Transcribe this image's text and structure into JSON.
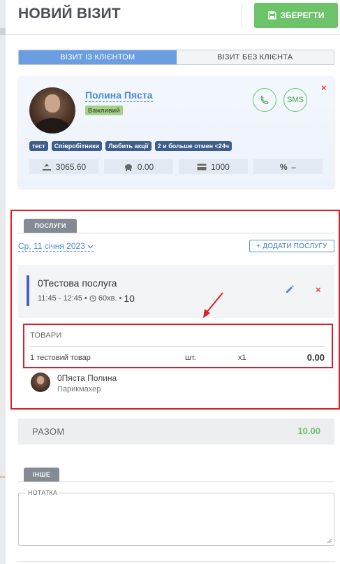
{
  "header": {
    "title": "НОВИЙ ВІЗИТ",
    "save_label": "ЗБЕРЕГТИ"
  },
  "visit_type": {
    "options": [
      "ВІЗИТ ІЗ КЛІЄНТОМ",
      "ВІЗИТ БЕЗ КЛІЄНТА"
    ],
    "selected": "ВІЗИТ ІЗ КЛІЄНТОМ"
  },
  "client": {
    "name": "Полина Пяста",
    "badge": "Важливий",
    "sms_label": "SMS",
    "close_symbol": "×",
    "tags": [
      "тест",
      "Співробітники",
      "Любить акції",
      "2 и больше отмен <24ч"
    ],
    "stats": {
      "spent": "3065.60",
      "balance": "0.00",
      "card": "1000",
      "discount": "–"
    }
  },
  "services_section": {
    "tab_label": "ПОСЛУГИ",
    "date": "Ср, 11 січня 2023",
    "add_label": "+ ДОДАТИ ПОСЛУГУ",
    "service": {
      "name": "0Тестова послуга",
      "time": "11:45 - 12:45",
      "separator": "•",
      "duration": "60хв.",
      "count": "10",
      "delete_symbol": "×"
    },
    "goods": {
      "title": "ТОВАРИ",
      "items": [
        {
          "name": "1 тестовий товар",
          "unit": "шт.",
          "qty": "x1",
          "total": "0.00"
        }
      ]
    },
    "master": {
      "name": "0Пяста Полина",
      "role": "Парикмахер"
    }
  },
  "total": {
    "label": "РАЗОМ",
    "value": "10.00"
  },
  "other_section": {
    "tab_label": "ІНШЕ",
    "note_label": "НОТАТКА",
    "note_value": ""
  },
  "colors": {
    "accent_blue": "#4a8bd6",
    "save_green": "#6cc36a",
    "highlight_red": "#dc1f26",
    "tag_blue": "#3d5d8c",
    "service_accent": "#4b5fc8"
  },
  "icons": [
    "save-icon",
    "phone-icon",
    "sms-icon",
    "close-icon",
    "wallet-icon",
    "piggy-bank-icon",
    "credit-card-icon",
    "percent-icon",
    "chevron-down-icon",
    "clock-icon",
    "pencil-icon",
    "annotation-arrow",
    "resize-handle-icon"
  ]
}
